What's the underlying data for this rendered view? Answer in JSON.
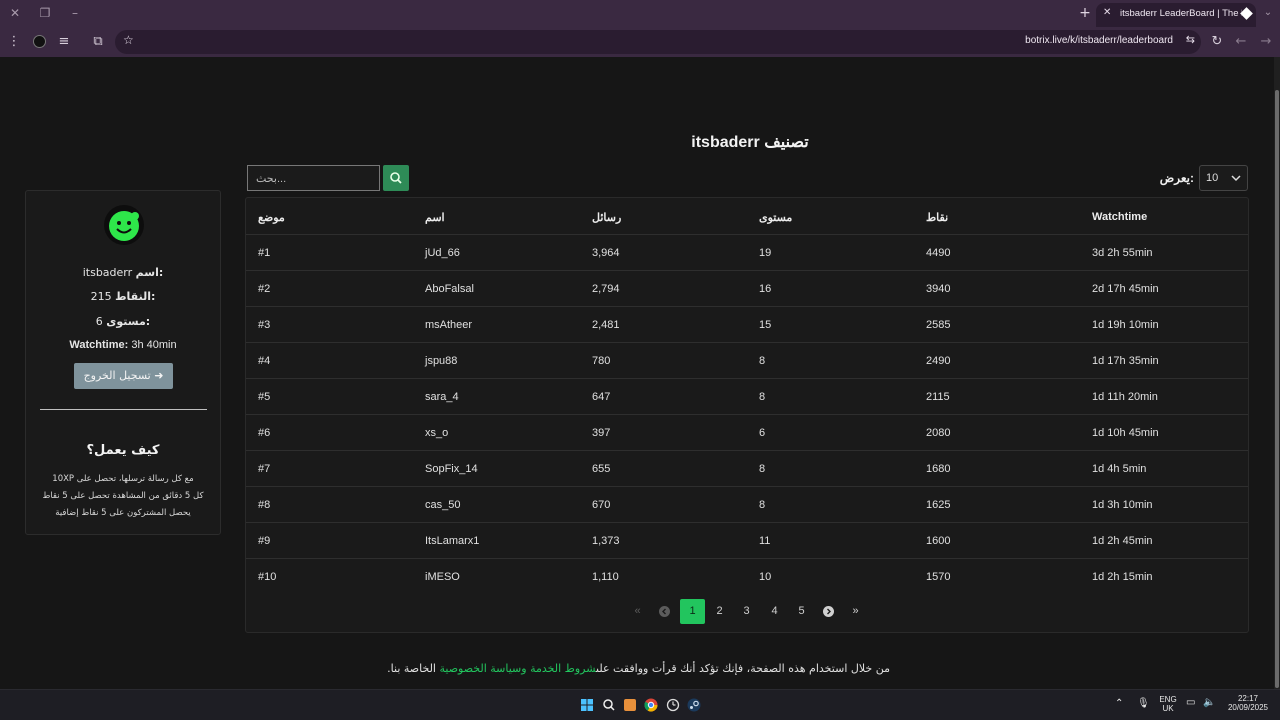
{
  "browser": {
    "tab_title": "itsbaderr LeaderBoard | The be",
    "url": "botrix.live/k/itsbaderr/leaderboard"
  },
  "leaderboard": {
    "title": "itsbaderr تصنيف",
    "search_placeholder": "بحث...",
    "show_label": "يعرض:",
    "show_value": "10",
    "columns": {
      "position": "موضع",
      "name": "اسم",
      "messages": "رسائل",
      "level": "مستوى",
      "points": "نقاط",
      "watchtime": "Watchtime"
    },
    "rows": [
      {
        "position": "#1",
        "name": "jUd_66",
        "messages": "3,964",
        "level": "19",
        "points": "4490",
        "watchtime": "3d 2h 55min"
      },
      {
        "position": "#2",
        "name": "AboFalsal",
        "messages": "2,794",
        "level": "16",
        "points": "3940",
        "watchtime": "2d 17h 45min"
      },
      {
        "position": "#3",
        "name": "msAtheer",
        "messages": "2,481",
        "level": "15",
        "points": "2585",
        "watchtime": "1d 19h 10min"
      },
      {
        "position": "#4",
        "name": "jspu88",
        "messages": "780",
        "level": "8",
        "points": "2490",
        "watchtime": "1d 17h 35min"
      },
      {
        "position": "#5",
        "name": "sara_4",
        "messages": "647",
        "level": "8",
        "points": "2115",
        "watchtime": "1d 11h 20min"
      },
      {
        "position": "#6",
        "name": "xs_o",
        "messages": "397",
        "level": "6",
        "points": "2080",
        "watchtime": "1d 10h 45min"
      },
      {
        "position": "#7",
        "name": "SopFix_14",
        "messages": "655",
        "level": "8",
        "points": "1680",
        "watchtime": "1d 4h 5min"
      },
      {
        "position": "#8",
        "name": "cas_50",
        "messages": "670",
        "level": "8",
        "points": "1625",
        "watchtime": "1d 3h 10min"
      },
      {
        "position": "#9",
        "name": "ItsLamarx1",
        "messages": "1,373",
        "level": "11",
        "points": "1600",
        "watchtime": "1d 2h 45min"
      },
      {
        "position": "#10",
        "name": "iMESO",
        "messages": "1,110",
        "level": "10",
        "points": "1570",
        "watchtime": "1d 2h 15min"
      }
    ],
    "pagination": {
      "first": "«",
      "prev": "‹",
      "pages": [
        "1",
        "2",
        "3",
        "4",
        "5"
      ],
      "active": "1",
      "next": "›",
      "last": "»"
    }
  },
  "profile": {
    "name_label": "اسم:",
    "name_value": "itsbaderr",
    "points_label": "النقاط:",
    "points_value": "215",
    "level_label": "مستوى:",
    "level_value": "6",
    "watchtime_label": "Watchtime:",
    "watchtime_value": "3h 40min",
    "logout_label": "تسجيل الخروج",
    "how_title": "كيف يعمل؟",
    "how_lines": [
      "مع كل رسالة ترسلها، تحصل على 10XP",
      "كل 5 دقائق من المشاهدة تحصل على 5 نقاط",
      "يحصل المشتركون على 5 نقاط إضافية"
    ]
  },
  "footer": {
    "before": "من خلال استخدام هذه الصفحة، فإنك تؤكد أنك قرأت ووافقت على",
    "link": "شروط الخدمة وسياسة الخصوصية",
    "after": "الخاصة بنا."
  },
  "taskbar": {
    "lang_line1": "ENG",
    "lang_line2": "UK",
    "time": "22:17",
    "date": "20/09/2025"
  }
}
